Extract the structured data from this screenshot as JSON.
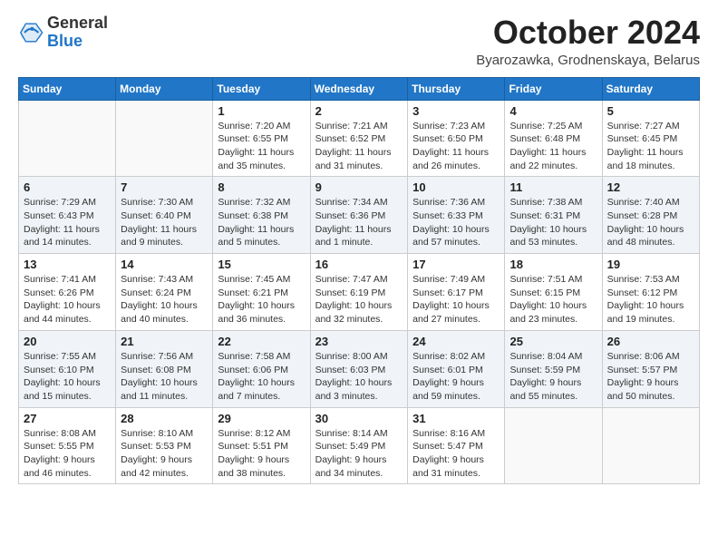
{
  "header": {
    "logo": {
      "line1": "General",
      "line2": "Blue"
    },
    "title": "October 2024",
    "location": "Byarozawka, Grodnenskaya, Belarus"
  },
  "days_of_week": [
    "Sunday",
    "Monday",
    "Tuesday",
    "Wednesday",
    "Thursday",
    "Friday",
    "Saturday"
  ],
  "weeks": [
    [
      {
        "day": "",
        "info": ""
      },
      {
        "day": "",
        "info": ""
      },
      {
        "day": "1",
        "info": "Sunrise: 7:20 AM\nSunset: 6:55 PM\nDaylight: 11 hours and 35 minutes."
      },
      {
        "day": "2",
        "info": "Sunrise: 7:21 AM\nSunset: 6:52 PM\nDaylight: 11 hours and 31 minutes."
      },
      {
        "day": "3",
        "info": "Sunrise: 7:23 AM\nSunset: 6:50 PM\nDaylight: 11 hours and 26 minutes."
      },
      {
        "day": "4",
        "info": "Sunrise: 7:25 AM\nSunset: 6:48 PM\nDaylight: 11 hours and 22 minutes."
      },
      {
        "day": "5",
        "info": "Sunrise: 7:27 AM\nSunset: 6:45 PM\nDaylight: 11 hours and 18 minutes."
      }
    ],
    [
      {
        "day": "6",
        "info": "Sunrise: 7:29 AM\nSunset: 6:43 PM\nDaylight: 11 hours and 14 minutes."
      },
      {
        "day": "7",
        "info": "Sunrise: 7:30 AM\nSunset: 6:40 PM\nDaylight: 11 hours and 9 minutes."
      },
      {
        "day": "8",
        "info": "Sunrise: 7:32 AM\nSunset: 6:38 PM\nDaylight: 11 hours and 5 minutes."
      },
      {
        "day": "9",
        "info": "Sunrise: 7:34 AM\nSunset: 6:36 PM\nDaylight: 11 hours and 1 minute."
      },
      {
        "day": "10",
        "info": "Sunrise: 7:36 AM\nSunset: 6:33 PM\nDaylight: 10 hours and 57 minutes."
      },
      {
        "day": "11",
        "info": "Sunrise: 7:38 AM\nSunset: 6:31 PM\nDaylight: 10 hours and 53 minutes."
      },
      {
        "day": "12",
        "info": "Sunrise: 7:40 AM\nSunset: 6:28 PM\nDaylight: 10 hours and 48 minutes."
      }
    ],
    [
      {
        "day": "13",
        "info": "Sunrise: 7:41 AM\nSunset: 6:26 PM\nDaylight: 10 hours and 44 minutes."
      },
      {
        "day": "14",
        "info": "Sunrise: 7:43 AM\nSunset: 6:24 PM\nDaylight: 10 hours and 40 minutes."
      },
      {
        "day": "15",
        "info": "Sunrise: 7:45 AM\nSunset: 6:21 PM\nDaylight: 10 hours and 36 minutes."
      },
      {
        "day": "16",
        "info": "Sunrise: 7:47 AM\nSunset: 6:19 PM\nDaylight: 10 hours and 32 minutes."
      },
      {
        "day": "17",
        "info": "Sunrise: 7:49 AM\nSunset: 6:17 PM\nDaylight: 10 hours and 27 minutes."
      },
      {
        "day": "18",
        "info": "Sunrise: 7:51 AM\nSunset: 6:15 PM\nDaylight: 10 hours and 23 minutes."
      },
      {
        "day": "19",
        "info": "Sunrise: 7:53 AM\nSunset: 6:12 PM\nDaylight: 10 hours and 19 minutes."
      }
    ],
    [
      {
        "day": "20",
        "info": "Sunrise: 7:55 AM\nSunset: 6:10 PM\nDaylight: 10 hours and 15 minutes."
      },
      {
        "day": "21",
        "info": "Sunrise: 7:56 AM\nSunset: 6:08 PM\nDaylight: 10 hours and 11 minutes."
      },
      {
        "day": "22",
        "info": "Sunrise: 7:58 AM\nSunset: 6:06 PM\nDaylight: 10 hours and 7 minutes."
      },
      {
        "day": "23",
        "info": "Sunrise: 8:00 AM\nSunset: 6:03 PM\nDaylight: 10 hours and 3 minutes."
      },
      {
        "day": "24",
        "info": "Sunrise: 8:02 AM\nSunset: 6:01 PM\nDaylight: 9 hours and 59 minutes."
      },
      {
        "day": "25",
        "info": "Sunrise: 8:04 AM\nSunset: 5:59 PM\nDaylight: 9 hours and 55 minutes."
      },
      {
        "day": "26",
        "info": "Sunrise: 8:06 AM\nSunset: 5:57 PM\nDaylight: 9 hours and 50 minutes."
      }
    ],
    [
      {
        "day": "27",
        "info": "Sunrise: 8:08 AM\nSunset: 5:55 PM\nDaylight: 9 hours and 46 minutes."
      },
      {
        "day": "28",
        "info": "Sunrise: 8:10 AM\nSunset: 5:53 PM\nDaylight: 9 hours and 42 minutes."
      },
      {
        "day": "29",
        "info": "Sunrise: 8:12 AM\nSunset: 5:51 PM\nDaylight: 9 hours and 38 minutes."
      },
      {
        "day": "30",
        "info": "Sunrise: 8:14 AM\nSunset: 5:49 PM\nDaylight: 9 hours and 34 minutes."
      },
      {
        "day": "31",
        "info": "Sunrise: 8:16 AM\nSunset: 5:47 PM\nDaylight: 9 hours and 31 minutes."
      },
      {
        "day": "",
        "info": ""
      },
      {
        "day": "",
        "info": ""
      }
    ]
  ]
}
